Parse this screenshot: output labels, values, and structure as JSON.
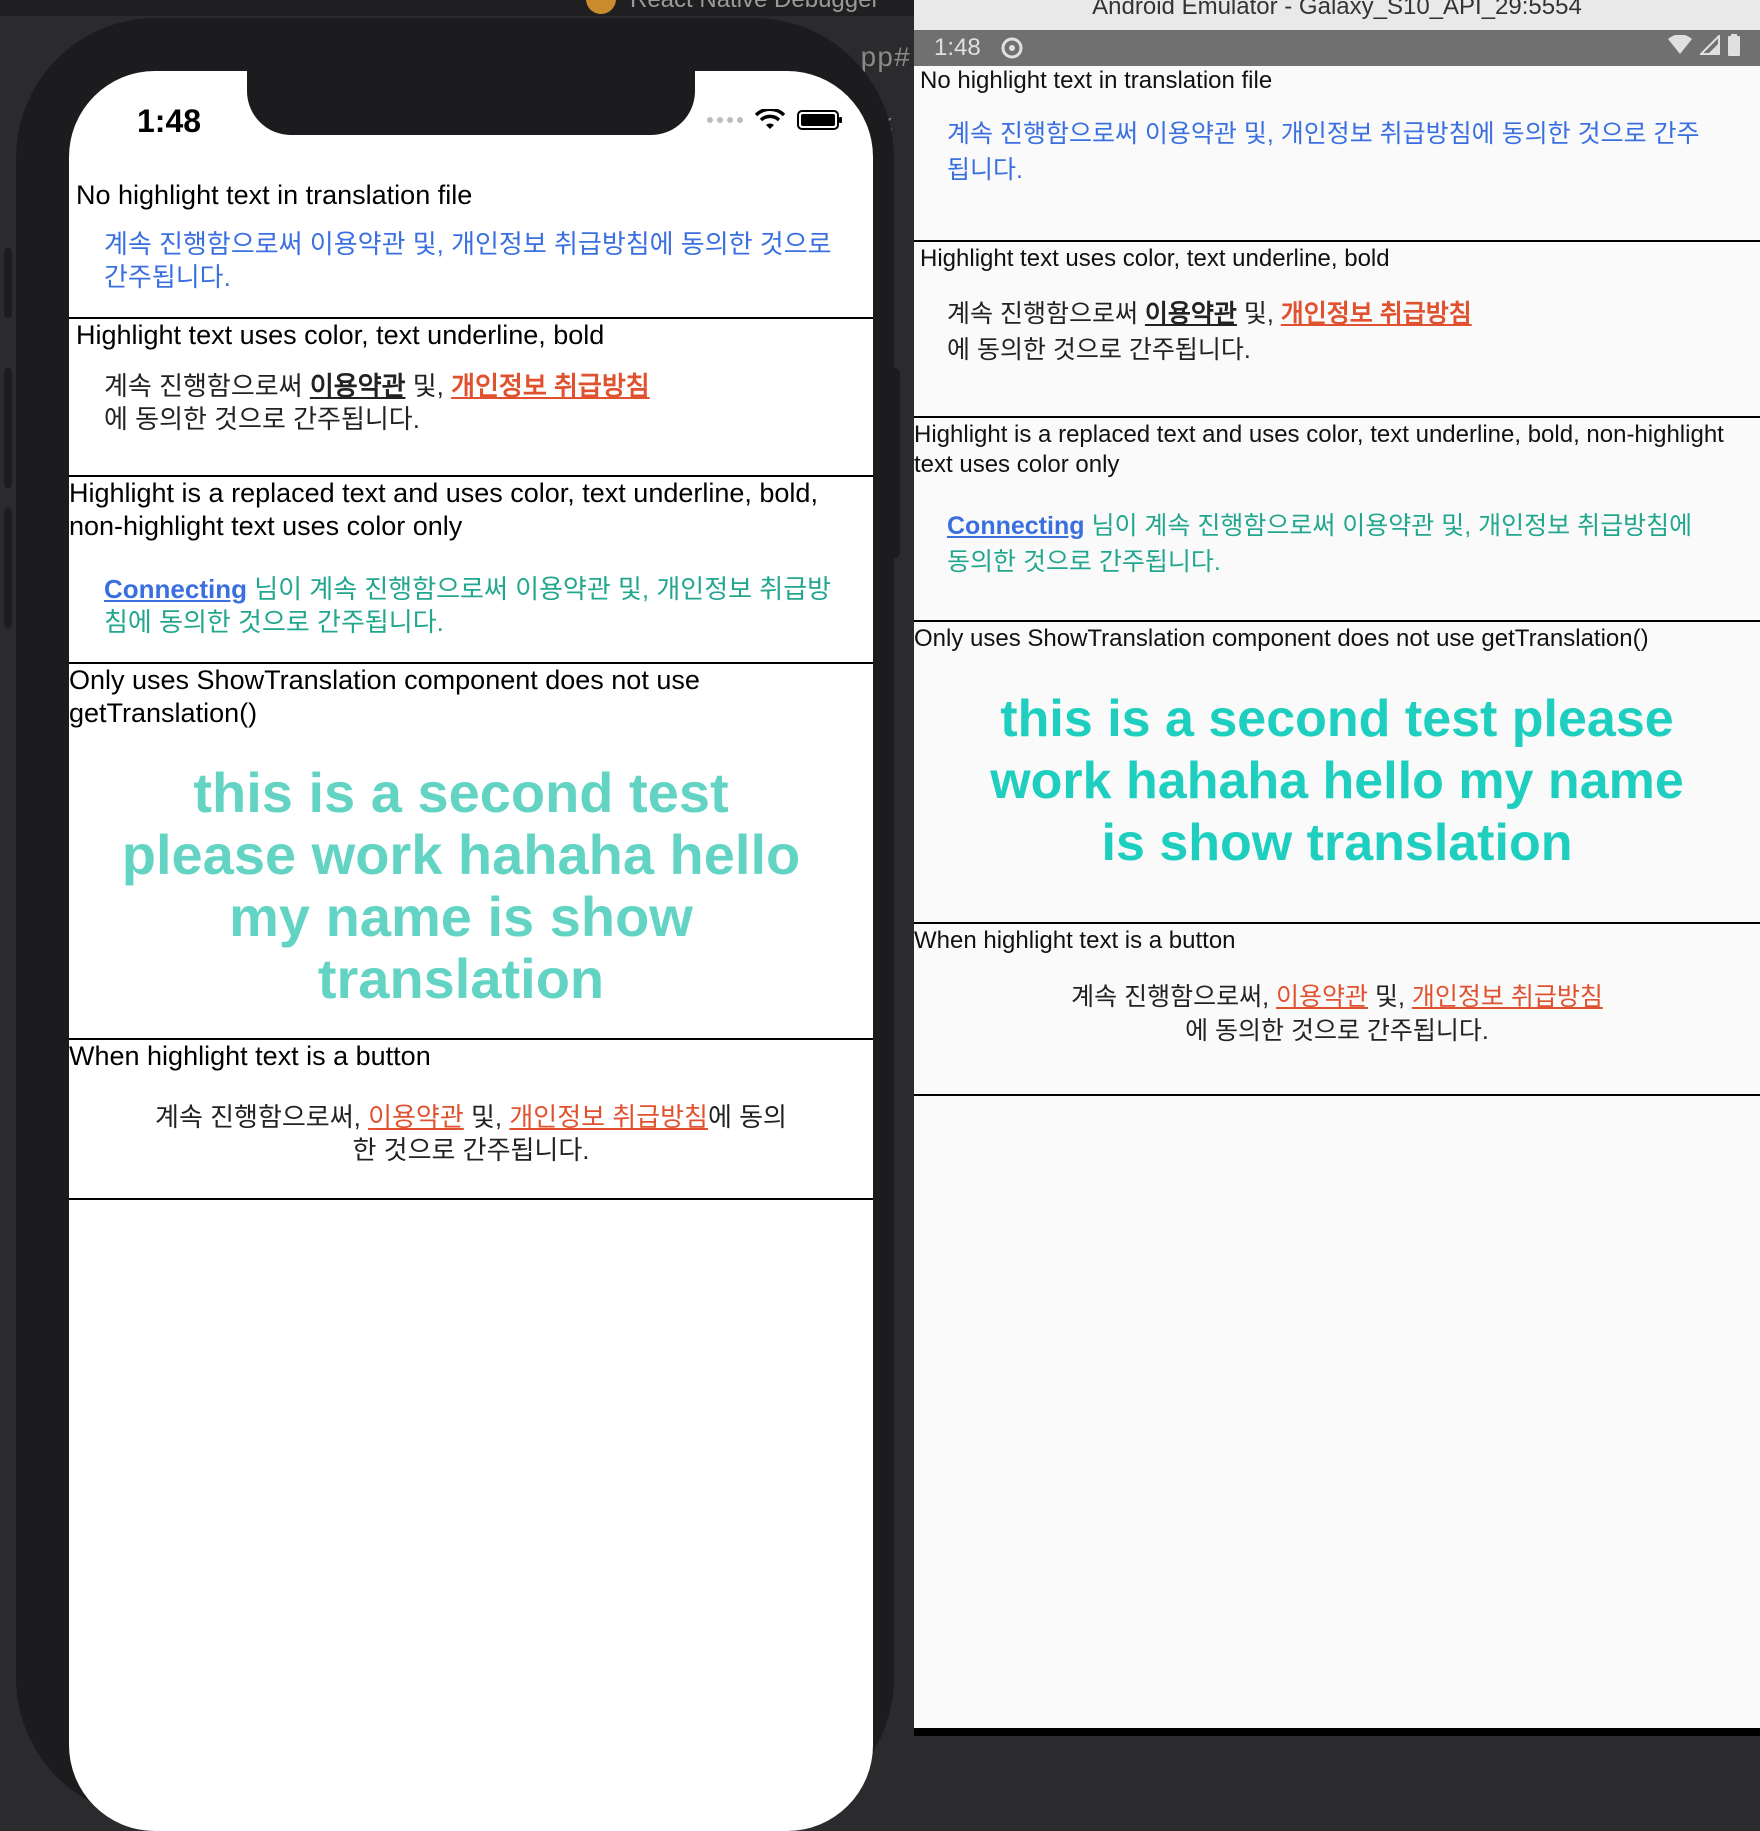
{
  "debugger": {
    "title": "React Native Debugger",
    "bg_code_1": "pp#",
    "bg_code_2": "k"
  },
  "colors": {
    "blue": "#3a6fe0",
    "red": "#e0522f",
    "teal_ios": "#63d4c4",
    "teal_android": "#1ecfc0",
    "teal_text": "#22a78e"
  },
  "ios": {
    "time": "1:48",
    "sections": [
      {
        "label": "No highlight text in translation file",
        "text": "계속 진행함으로써 이용약관 및, 개인정보 취급방침에 동의한 것으로 간주됩니다."
      },
      {
        "label": "Highlight text uses color, text underline, bold",
        "pre": "계속 진행함으로써 ",
        "hl1": "이용약관",
        "mid": " 및, ",
        "hl2": "개인정보 취급방침",
        "post": "에 동의한 것으로 간주됩니다."
      },
      {
        "label": "Highlight is a replaced text and uses color, text underline, bold, non-highlight text uses color only",
        "hl": "Connecting",
        "text": " 님이 계속 진행함으로써 이용약관 및, 개인정보 취급방침에 동의한 것으로 간주됩니다."
      },
      {
        "label": "Only uses ShowTranslation component does not use getTranslation()",
        "big": "this is a second test please work hahaha hello my name is show translation"
      },
      {
        "label": "When highlight text is a button",
        "pre": "계속 진행함으로써, ",
        "hl1": "이용약관",
        "mid": " 및, ",
        "hl2": "개인정보 취급방침",
        "post": "에 동의한 것으로 간주됩니다."
      }
    ]
  },
  "android": {
    "window_title": "Android Emulator - Galaxy_S10_API_29:5554",
    "time": "1:48",
    "sections": [
      {
        "label": "No highlight text in translation file",
        "text": "계속 진행함으로써 이용약관 및, 개인정보 취급방침에 동의한 것으로 간주됩니다."
      },
      {
        "label": "Highlight text uses color, text underline, bold",
        "pre": "계속 진행함으로써 ",
        "hl1": "이용약관",
        "mid": " 및, ",
        "hl2": "개인정보 취급방침",
        "post": "에 동의한 것으로 간주됩니다."
      },
      {
        "label": "Highlight is a replaced text and uses color, text underline, bold, non-highlight text uses color only",
        "hl": "Connecting",
        "text": " 님이 계속 진행함으로써 이용약관 및, 개인정보 취급방침에 동의한 것으로 간주됩니다."
      },
      {
        "label": "Only uses ShowTranslation component does not use getTranslation()",
        "big": "this is a second test please work hahaha hello my name is show translation"
      },
      {
        "label": "When highlight text is a button",
        "pre": "계속 진행함으로써, ",
        "hl1": "이용약관",
        "mid": " 및, ",
        "hl2": "개인정보 취급방침",
        "post": "에 동의한 것으로 간주됩니다."
      }
    ]
  }
}
